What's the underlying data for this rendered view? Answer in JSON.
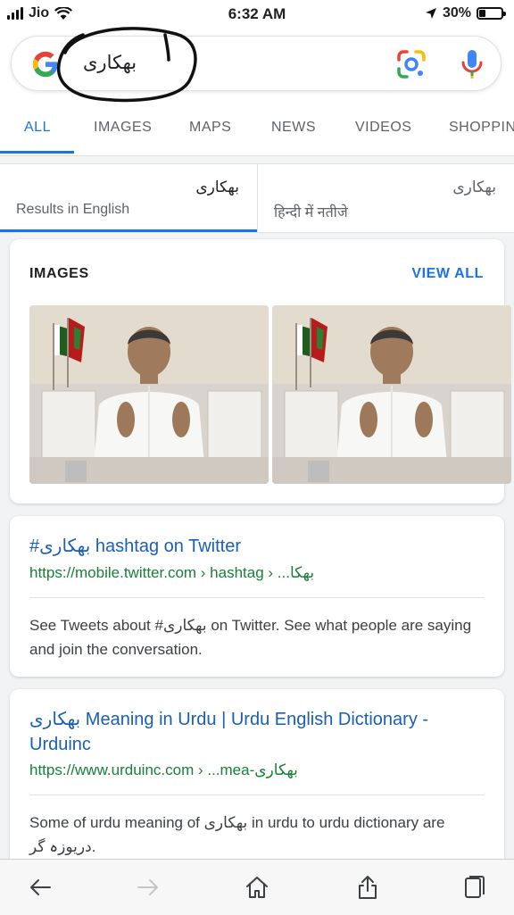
{
  "status_bar": {
    "carrier": "Jio",
    "time": "6:32 AM",
    "battery": "30%",
    "battery_level": 0.3
  },
  "search": {
    "query": "بھکاری"
  },
  "tabs": [
    "ALL",
    "IMAGES",
    "MAPS",
    "NEWS",
    "VIDEOS",
    "SHOPPIN"
  ],
  "language_chips": [
    {
      "term": "بھکاری",
      "label": "Results in English"
    },
    {
      "term": "بھکاری",
      "label": "हिन्दी में नतीजे"
    }
  ],
  "images_section": {
    "heading": "IMAGES",
    "view_all": "VIEW ALL"
  },
  "results": [
    {
      "title": "#بھکاری hashtag on Twitter",
      "url": "https://mobile.twitter.com › hashtag › ...بھکا",
      "snippet": "See Tweets about #بھکاری on Twitter. See what people are saying and join the conversation."
    },
    {
      "title": "بھکاری Meaning in Urdu | Urdu English Dictionary - Urduinc",
      "url": "https://www.urduinc.com › ...mea-بھکاری",
      "snippet": "Some of urdu meaning of بھکاری in urdu to urdu dictionary are دریوزہ گر."
    }
  ],
  "colors": {
    "accent": "#1a73e8",
    "link": "#1a5fb4",
    "url": "#188038"
  },
  "icons": [
    "google-g-icon",
    "google-lens-icon",
    "microphone-icon",
    "back-arrow-icon",
    "forward-arrow-icon",
    "home-icon",
    "share-icon",
    "tabs-icon"
  ]
}
